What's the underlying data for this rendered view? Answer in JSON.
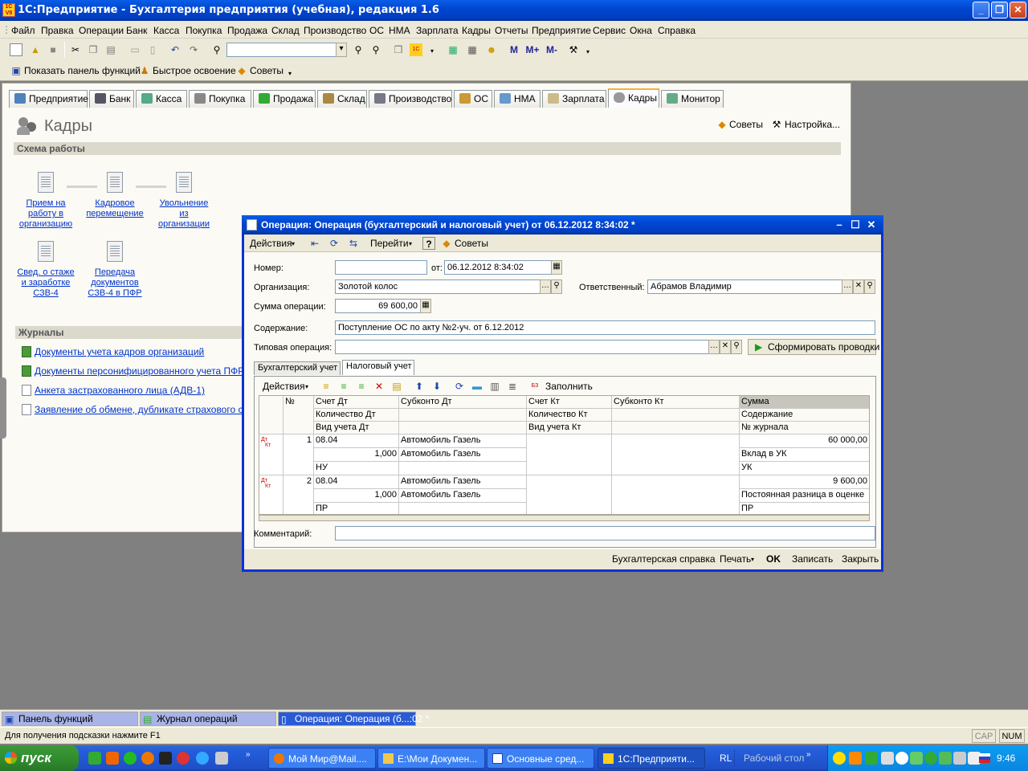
{
  "app": {
    "title": "1С:Предприятие - Бухгалтерия предприятия (учебная), редакция 1.6",
    "icon_text": "1C V8"
  },
  "menu": [
    "Файл",
    "Правка",
    "Операции",
    "Банк",
    "Касса",
    "Покупка",
    "Продажа",
    "Склад",
    "Производство",
    "ОС",
    "НМА",
    "Зарплата",
    "Кадры",
    "Отчеты",
    "Предприятие",
    "Сервис",
    "Окна",
    "Справка"
  ],
  "toolbar2": {
    "show_panel": "Показать панель функций",
    "quick_learn": "Быстрое освоение",
    "tips": "Советы"
  },
  "panel": {
    "tabs": [
      "Предприятие",
      "Банк",
      "Касса",
      "Покупка",
      "Продажа",
      "Склад",
      "Производство",
      "ОС",
      "НМА",
      "Зарплата",
      "Кадры",
      "Монитор"
    ],
    "active_tab": "Кадры",
    "title": "Кадры",
    "tips": "Советы",
    "settings": "Настройка...",
    "schema_header": "Схема работы",
    "schema": [
      {
        "l1": "Прием на",
        "l2": "работу в",
        "l3": "организацию"
      },
      {
        "l1": "Кадровое",
        "l2": "перемещение",
        "l3": ""
      },
      {
        "l1": "Увольнение",
        "l2": "из",
        "l3": "организации"
      },
      {
        "l1": "Свед. о стаже",
        "l2": "и заработке",
        "l3": "СЗВ-4"
      },
      {
        "l1": "Передача",
        "l2": "документов",
        "l3": "СЗВ-4 в ПФР"
      }
    ],
    "journals_header": "Журналы",
    "journals": [
      "Документы учета кадров организаций",
      "Документы персонифицированного учета ПФР",
      "Анкета застрахованного лица (АДВ-1)",
      "Заявление об обмене, дубликате страхового св-ва"
    ]
  },
  "dialog": {
    "title": "Операция: Операция (бухгалтерский и налоговый учет)  от 06.12.2012 8:34:02 *",
    "toolbar": {
      "actions": "Действия",
      "goto": "Перейти",
      "tips": "Советы"
    },
    "labels": {
      "number": "Номер:",
      "from": "от:",
      "organization": "Организация:",
      "responsible": "Ответственный:",
      "sum": "Сумма операции:",
      "content": "Содержание:",
      "typical": "Типовая операция:",
      "comment": "Комментарий:"
    },
    "values": {
      "number": "",
      "date": "06.12.2012  8:34:02",
      "organization": "Золотой колос",
      "responsible": "Абрамов Владимир",
      "sum": "69 600,00",
      "content": "Поступление ОС по акту №2-уч. от 6.12.2012",
      "typical": "",
      "comment": ""
    },
    "generate_button": "Сформировать проводки",
    "tabs": [
      "Бухгалтерский учет",
      "Налоговый учет"
    ],
    "active_tab": "Налоговый учет",
    "grid_toolbar": {
      "actions": "Действия",
      "fill": "Заполнить"
    },
    "grid": {
      "headers": {
        "n": "№",
        "r1": [
          "Счет Дт",
          "Субконто Дт",
          "Счет Кт",
          "Субконто Кт",
          "Сумма"
        ],
        "r2": [
          "Количество Дт",
          "",
          "Количество Кт",
          "",
          "Содержание"
        ],
        "r3": [
          "Вид учета Дт",
          "",
          "Вид учета Кт",
          "",
          "№ журнала"
        ]
      },
      "rows": [
        {
          "n": "1",
          "dt": "08.04",
          "sub_dt": "Автомобиль Газель",
          "kt": "",
          "sub_kt": "",
          "sum": "60 000,00",
          "qty_dt": "1,000",
          "sub_dt2": "Автомобиль Газель",
          "qty_kt": "",
          "content": "Вклад в УК",
          "vid_dt": "НУ",
          "vid_kt": "",
          "journal": "УК"
        },
        {
          "n": "2",
          "dt": "08.04",
          "sub_dt": "Автомобиль Газель",
          "kt": "",
          "sub_kt": "",
          "sum": "9 600,00",
          "qty_dt": "1,000",
          "sub_dt2": "Автомобиль Газель",
          "qty_kt": "",
          "content": "Постоянная разница в оценке",
          "vid_dt": "ПР",
          "vid_kt": "",
          "journal": "ПР"
        }
      ],
      "row_icon": {
        "top": "Дт",
        "bottom": "Кт"
      }
    },
    "bottom": {
      "report": "Бухгалтерская справка",
      "print": "Печать",
      "ok": "OK",
      "save": "Записать",
      "close": "Закрыть"
    }
  },
  "window_tabs": [
    "Панель функций",
    "Журнал операций",
    "Операция: Операция (б...:02 *"
  ],
  "status": {
    "hint": "Для получения подсказки нажмите F1",
    "cap": "CAP",
    "num": "NUM"
  },
  "taskbar": {
    "start": "пуск",
    "tasks": [
      "Мой Мир@Mail....",
      "E:\\Мои Докумен...",
      "Основные сред...",
      "1С:Предприяти..."
    ],
    "lang": "RL",
    "desktop": "Рабочий стол",
    "clock": "9:46"
  }
}
